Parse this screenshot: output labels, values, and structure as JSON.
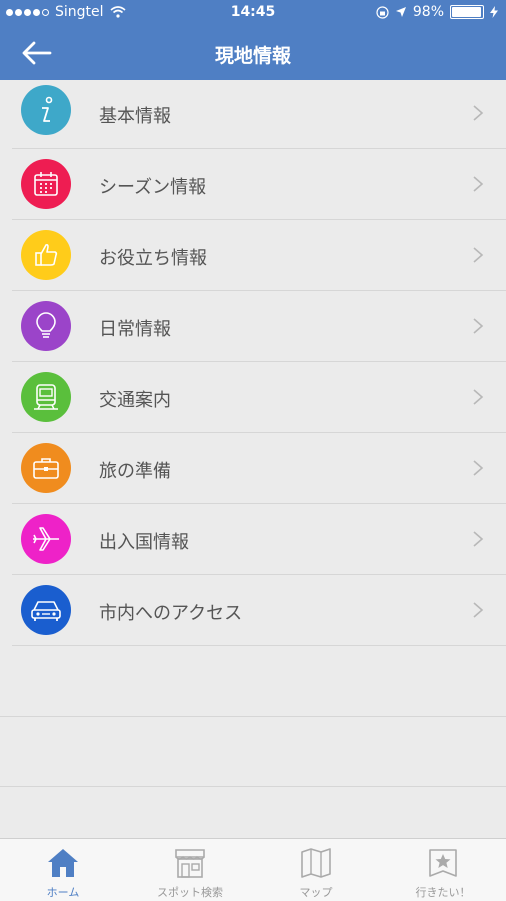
{
  "status": {
    "carrier": "Singtel",
    "time": "14:45",
    "battery": "98%",
    "battery_level": 0.98
  },
  "nav": {
    "title": "現地情報",
    "back_icon": "arrow-left-icon"
  },
  "menu": [
    {
      "label": "基本情報",
      "icon": "info-icon",
      "color": "#3ea8c9"
    },
    {
      "label": "シーズン情報",
      "icon": "calendar-icon",
      "color": "#ee1d52"
    },
    {
      "label": "お役立ち情報",
      "icon": "thumbs-up-icon",
      "color": "#ffcc1a"
    },
    {
      "label": "日常情報",
      "icon": "lightbulb-icon",
      "color": "#9b44c9"
    },
    {
      "label": "交通案内",
      "icon": "train-icon",
      "color": "#5abf3c"
    },
    {
      "label": "旅の準備",
      "icon": "briefcase-icon",
      "color": "#f08c1e"
    },
    {
      "label": "出入国情報",
      "icon": "airplane-icon",
      "color": "#ee22c8"
    },
    {
      "label": "市内へのアクセス",
      "icon": "car-icon",
      "color": "#1a5ecf"
    }
  ],
  "tabs": [
    {
      "label": "ホーム",
      "icon": "home-icon",
      "active": true
    },
    {
      "label": "スポット検索",
      "icon": "store-icon",
      "active": false
    },
    {
      "label": "マップ",
      "icon": "map-icon",
      "active": false
    },
    {
      "label": "行きたい！",
      "icon": "bookmark-star-icon",
      "active": false
    }
  ],
  "colors": {
    "accent": "#4f7fc4",
    "background": "#ebebeb",
    "tab_inactive": "#999999"
  }
}
